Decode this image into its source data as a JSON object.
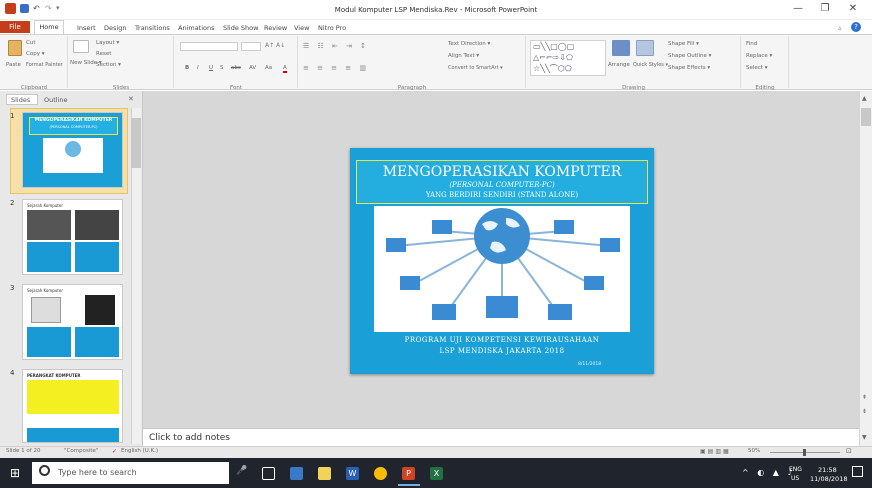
{
  "window": {
    "title": "Modul Komputer LSP Mendiska.Rev - Microsoft PowerPoint",
    "minimize": "—",
    "maximize": "❐",
    "close": "✕"
  },
  "tabs": {
    "file": "File",
    "items": [
      "Home",
      "Insert",
      "Design",
      "Transitions",
      "Animations",
      "Slide Show",
      "Review",
      "View",
      "Nitro Pro"
    ]
  },
  "ribbon": {
    "clipboard": {
      "paste": "Paste",
      "cut": "Cut",
      "copy": "Copy ▾",
      "format_painter": "Format Painter",
      "label": "Clipboard"
    },
    "slides": {
      "new_slide": "New Slide ▾",
      "layout": "Layout ▾",
      "reset": "Reset",
      "section": "Section ▾",
      "label": "Slides"
    },
    "font": {
      "label": "Font",
      "bold": "B",
      "italic": "I",
      "underline": "U",
      "strike": "S",
      "shadow": "abc",
      "spacing": "AV",
      "case": "Aa",
      "color": "A"
    },
    "paragraph": {
      "label": "Paragraph",
      "text_direction": "Text Direction ▾",
      "align_text": "Align Text ▾",
      "smartart": "Convert to SmartArt ▾"
    },
    "drawing": {
      "label": "Drawing",
      "arrange": "Arrange",
      "quick_styles": "Quick Styles ▾",
      "shape_fill": "Shape Fill ▾",
      "shape_outline": "Shape Outline ▾",
      "shape_effects": "Shape Effects ▾"
    },
    "editing": {
      "label": "Editing",
      "find": "Find",
      "replace": "Replace ▾",
      "select": "Select ▾"
    }
  },
  "pane": {
    "tab_slides": "Slides",
    "tab_outline": "Outline",
    "close": "✕",
    "thumbs": [
      {
        "num": "1",
        "title": "MENGOPERASIKAN KOMPUTER",
        "sub": "(PERSONAL COMPUTER-PC)"
      },
      {
        "num": "2",
        "title": "Sejarah Komputer"
      },
      {
        "num": "3",
        "title": "Sejarah Komputer"
      },
      {
        "num": "4",
        "title": "PERANGKAT KOMPUTER"
      }
    ]
  },
  "slide": {
    "title": "MENGOPERASIKAN KOMPUTER",
    "subtitle1": "(PERSONAL COMPUTER-PC)",
    "subtitle2": "YANG BERDIRI SENDIRI (STAND ALONE)",
    "footer1": "PROGRAM UJI KOMPETENSI KEWIRAUSAHAAN",
    "footer2": "LSP MENDISKA JAKARTA 2018",
    "date": "8/11/2018"
  },
  "notes": {
    "placeholder": "Click to add notes"
  },
  "status": {
    "slide": "Slide 1 of 20",
    "theme": "\"Composite\"",
    "language": "English (U.K.)",
    "zoom": "50%"
  },
  "taskbar": {
    "search": "Type here to search",
    "lang": "ENG",
    "region": "US",
    "time": "21:58",
    "date": "11/08/2018"
  }
}
